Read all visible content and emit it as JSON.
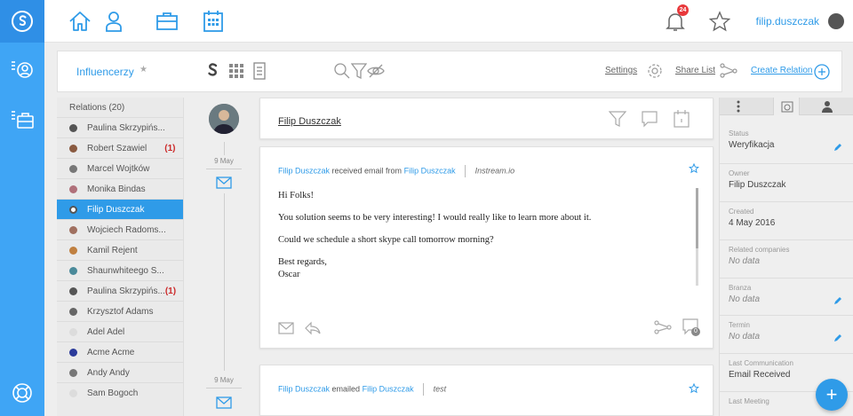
{
  "topbar": {
    "username": "filip.duszczak",
    "notification_count": "24",
    "nav_icons": [
      "home-icon",
      "user-icon",
      "briefcase-icon",
      "calendar-icon"
    ]
  },
  "subbar": {
    "list_name": "Influencerzy",
    "settings_label": "Settings",
    "share_label": "Share List",
    "create_label": "Create Relation"
  },
  "relations": {
    "header": "Relations (20)",
    "items": [
      {
        "name": "Paulina Skrzypińs...",
        "count": ""
      },
      {
        "name": "Robert Szawiel",
        "count": "(1)"
      },
      {
        "name": "Marcel Wojtków",
        "count": ""
      },
      {
        "name": "Monika Bindas",
        "count": ""
      },
      {
        "name": "Filip Duszczak",
        "count": ""
      },
      {
        "name": "Wojciech Radoms...",
        "count": ""
      },
      {
        "name": "Kamil Rejent",
        "count": ""
      },
      {
        "name": "Shaunwhiteego S...",
        "count": ""
      },
      {
        "name": "Paulina Skrzypińs...",
        "count": "(1)"
      },
      {
        "name": "Krzysztof Adams",
        "count": ""
      },
      {
        "name": "Adel Adel",
        "count": ""
      },
      {
        "name": "Acme Acme",
        "count": ""
      },
      {
        "name": "Andy Andy",
        "count": ""
      },
      {
        "name": "Sam Bogoch",
        "count": ""
      }
    ]
  },
  "timeline": {
    "date1": "9 May",
    "date2": "9 May"
  },
  "contact_card": {
    "name": "Filip Duszczak"
  },
  "email1": {
    "sender": "Filip Duszczak",
    "action": "received email from",
    "recipient": "Filip Duszczak",
    "source": "Instream.io",
    "greeting": "Hi Folks!",
    "line1": "You solution seems to be very interesting! I would really like to learn more about it.",
    "line2": "Could we schedule a short skype call tomorrow morning?",
    "closing": "Best regards,",
    "signature": "Oscar",
    "attachment_count": "0"
  },
  "email2": {
    "sender": "Filip Duszczak",
    "action": "emailed",
    "recipient": "Filip Duszczak",
    "subject": "test"
  },
  "details": {
    "status_label": "Status",
    "status_value": "Weryfikacja",
    "owner_label": "Owner",
    "owner_value": "Filip Duszczak",
    "created_label": "Created",
    "created_value": "4 May 2016",
    "related_label": "Related companies",
    "related_value": "No data",
    "branza_label": "Branza",
    "branza_value": "No data",
    "termin_label": "Termin",
    "termin_value": "No data",
    "lastcomm_label": "Last Communication",
    "lastcomm_value": "Email Received",
    "lastmeeting_label": "Last Meeting"
  },
  "fab_label": "+",
  "colors": {
    "accent": "#2f9be8",
    "sidebar": "#3fa5f5",
    "alert": "#e8383b"
  }
}
